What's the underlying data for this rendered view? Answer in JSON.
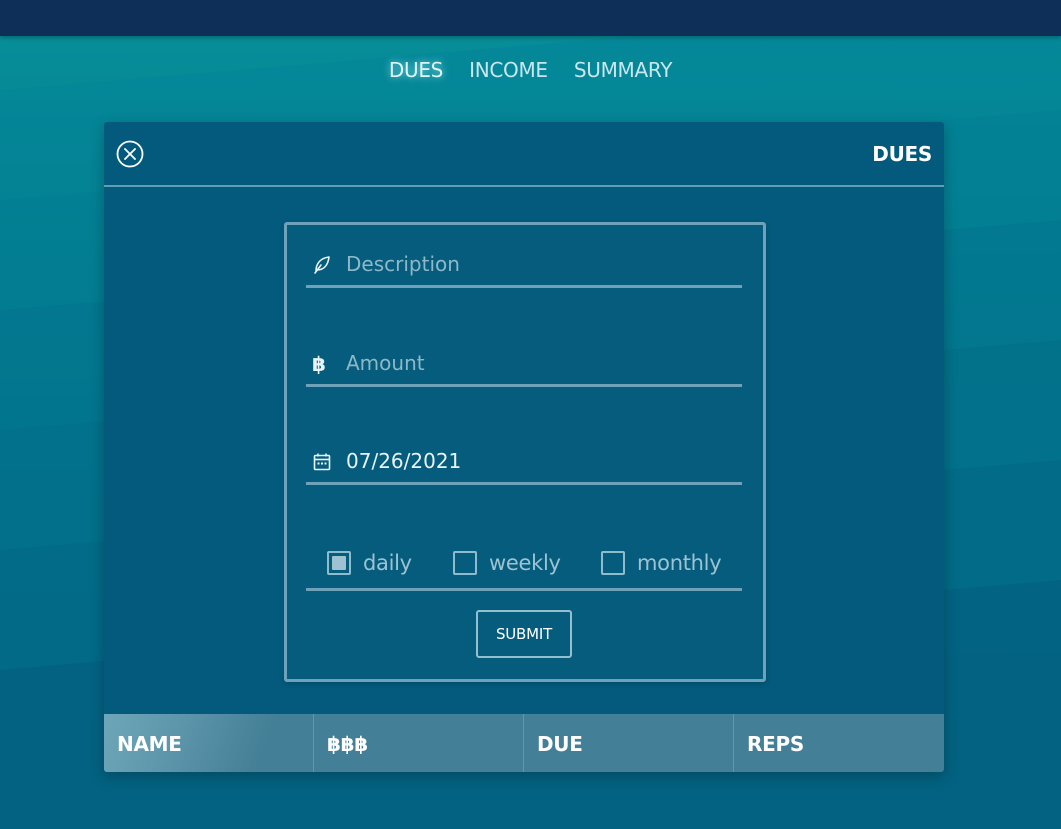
{
  "nav": {
    "items": [
      "DUES",
      "INCOME",
      "SUMMARY"
    ],
    "active": "DUES"
  },
  "panel": {
    "title": "DUES",
    "close_icon": "close-circle-icon"
  },
  "form": {
    "description": {
      "icon": "feather-icon",
      "placeholder": "Description",
      "value": ""
    },
    "amount": {
      "icon": "bitcoin-icon",
      "icon_glyph": "฿",
      "placeholder": "Amount",
      "value": ""
    },
    "date": {
      "icon": "calendar-icon",
      "value": "07/26/2021"
    },
    "recurrence": [
      {
        "label": "daily",
        "checked": true
      },
      {
        "label": "weekly",
        "checked": false
      },
      {
        "label": "monthly",
        "checked": false
      }
    ],
    "submit_label": "SUBMIT"
  },
  "table": {
    "headers": [
      "NAME",
      "฿฿฿",
      "DUE",
      "REPS"
    ]
  },
  "colors": {
    "topbar": "#0e2f58",
    "panel": "#035a7d",
    "accent_border": "#6fa1b8",
    "header_row": "#437f96"
  }
}
